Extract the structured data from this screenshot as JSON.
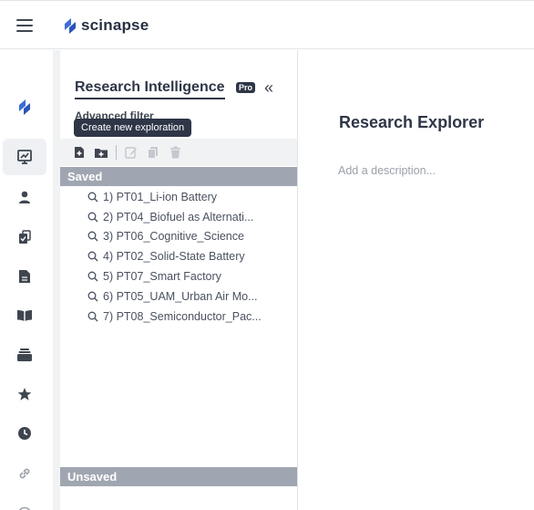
{
  "header": {
    "brand": "scinapse"
  },
  "panel": {
    "title": "Research Intelligence",
    "pro_badge": "Pro",
    "collapse_label": "«",
    "advanced_filter": "Advanced filter",
    "tooltip": "Create new exploration",
    "saved_label": "Saved",
    "unsaved_label": "Unsaved",
    "saved_items": [
      "1) PT01_Li-ion Battery",
      "2) PT04_Biofuel as Alternati...",
      "3) PT06_Cognitive_Science",
      "4) PT02_Solid-State Battery",
      "5) PT07_Smart Factory",
      "6) PT05_UAM_Urban Air Mo...",
      "7) PT08_Semiconductor_Pac..."
    ]
  },
  "main": {
    "title": "Research Explorer",
    "description_placeholder": "Add a description..."
  },
  "colors": {
    "brand_blue": "#3b6fd6",
    "section_gray": "#a0a6b1",
    "dark": "#2e3647"
  }
}
